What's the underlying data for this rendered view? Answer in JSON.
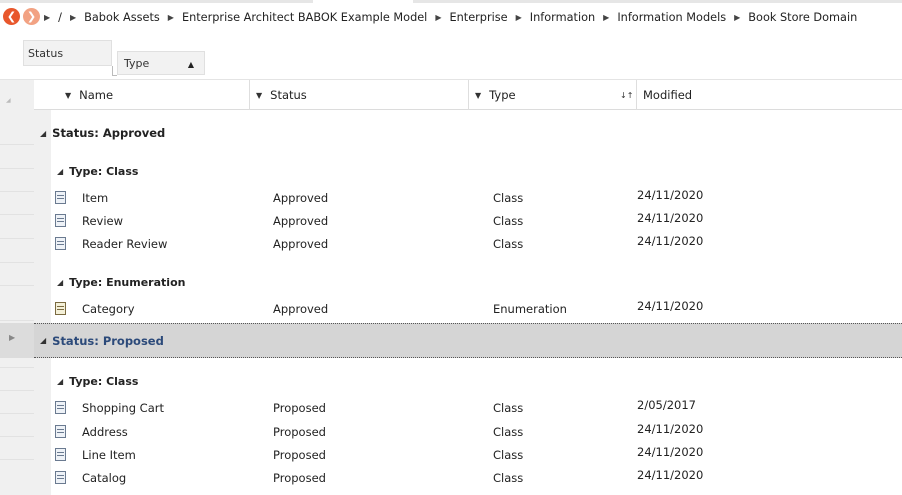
{
  "breadcrumb": {
    "root": "/",
    "items": [
      "Babok Assets",
      "Enterprise Architect BABOK Example Model",
      "Enterprise",
      "Information",
      "Information Models",
      "Book Store Domain"
    ],
    "separator": "▶"
  },
  "icons": {
    "back": "arrow-left-circle-icon",
    "forward": "arrow-right-circle-icon",
    "class": "class-element-icon",
    "enumeration": "enumeration-element-icon"
  },
  "group_by": {
    "levels": [
      "Status",
      "Type"
    ],
    "type_sort_glyph": "▲"
  },
  "columns": [
    {
      "label": "Name",
      "glyph": "▼"
    },
    {
      "label": "Status",
      "glyph": "▼"
    },
    {
      "label": "Type",
      "glyph": "▼"
    },
    {
      "label": "Modified",
      "glyph": "↓↑"
    }
  ],
  "groups": [
    {
      "label": "Status: Approved",
      "subgroups": [
        {
          "label": "Type: Class",
          "items": [
            {
              "name": "Item",
              "status": "Approved",
              "type": "Class",
              "modified": "24/11/2020"
            },
            {
              "name": "Review",
              "status": "Approved",
              "type": "Class",
              "modified": "24/11/2020"
            },
            {
              "name": "Reader Review",
              "status": "Approved",
              "type": "Class",
              "modified": "24/11/2020"
            }
          ]
        },
        {
          "label": "Type: Enumeration",
          "items": [
            {
              "name": "Category",
              "status": "Approved",
              "type": "Enumeration",
              "modified": "24/11/2020"
            }
          ]
        }
      ]
    },
    {
      "label": "Status: Proposed",
      "selected": true,
      "subgroups": [
        {
          "label": "Type: Class",
          "items": [
            {
              "name": "Shopping Cart",
              "status": "Proposed",
              "type": "Class",
              "modified": "2/05/2017"
            },
            {
              "name": "Address",
              "status": "Proposed",
              "type": "Class",
              "modified": "24/11/2020"
            },
            {
              "name": "Line Item",
              "status": "Proposed",
              "type": "Class",
              "modified": "24/11/2020"
            },
            {
              "name": "Catalog",
              "status": "Proposed",
              "type": "Class",
              "modified": "24/11/2020"
            }
          ]
        }
      ]
    }
  ],
  "colors": {
    "nav_back": "#e8572c",
    "nav_forward": "#f2a283",
    "selected_group_text": "#2c4a7a",
    "selected_group_bg": "#d5d5d5"
  }
}
